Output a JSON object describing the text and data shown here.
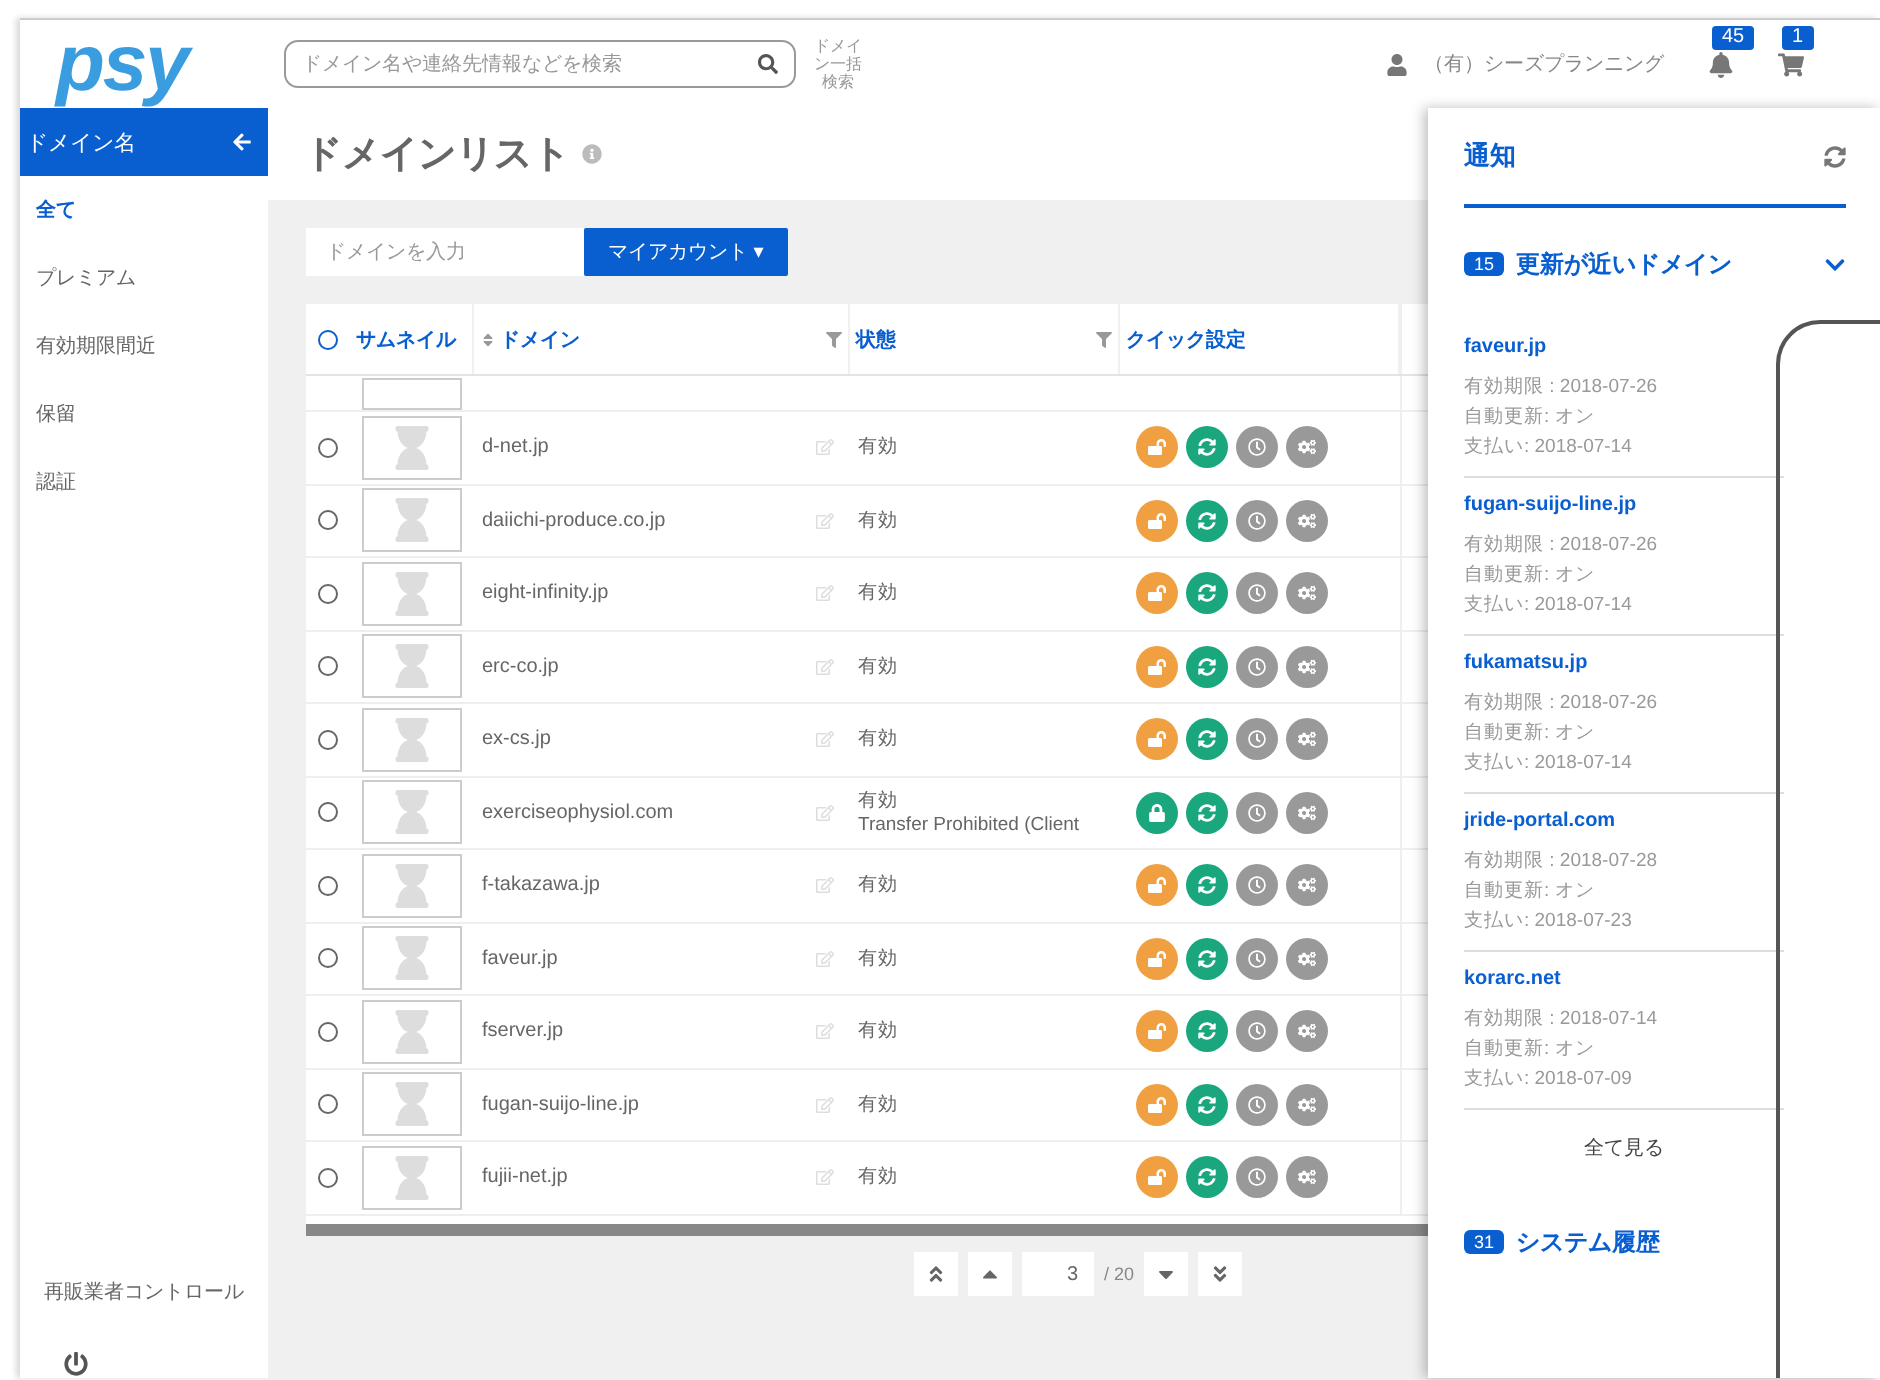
{
  "header": {
    "logo": "psy",
    "search": {
      "placeholder": "ドメイン名や連絡先情報などを検索"
    },
    "bulk_search": "ドメイン一括検索",
    "user": "（有）シーズプランニング",
    "notifications_badge": "45",
    "cart_badge": "1"
  },
  "sidebar": {
    "title": "ドメイン名",
    "items": [
      {
        "label": "全て",
        "selected": true
      },
      {
        "label": "プレミアム",
        "selected": false
      },
      {
        "label": "有効期限間近",
        "selected": false
      },
      {
        "label": "保留",
        "selected": false
      },
      {
        "label": "認証",
        "selected": false
      }
    ],
    "footer": "再販業者コントロール"
  },
  "page": {
    "title": "ドメインリスト",
    "filter": {
      "placeholder": "ドメインを入力"
    },
    "account_button": "マイアカウント ▾"
  },
  "table": {
    "all_selected": false,
    "columns": [
      {
        "label": "サムネイル",
        "sortable": false,
        "filter": false
      },
      {
        "label": "ドメイン",
        "sortable": true,
        "filter": true
      },
      {
        "label": "状態",
        "sortable": false,
        "filter": true
      },
      {
        "label": "クイック設定",
        "sortable": false,
        "filter": false
      }
    ],
    "rows": [
      {
        "domain": "d-net.jp",
        "status": [
          "有効"
        ],
        "locked": false,
        "selected": false
      },
      {
        "domain": "daiichi-produce.co.jp",
        "status": [
          "有効"
        ],
        "locked": false,
        "selected": false
      },
      {
        "domain": "eight-infinity.jp",
        "status": [
          "有効"
        ],
        "locked": false,
        "selected": false
      },
      {
        "domain": "erc-co.jp",
        "status": [
          "有効"
        ],
        "locked": false,
        "selected": false
      },
      {
        "domain": "ex-cs.jp",
        "status": [
          "有効"
        ],
        "locked": false,
        "selected": false
      },
      {
        "domain": "exerciseophysiol.com",
        "status": [
          "有効",
          "Transfer Prohibited (Client"
        ],
        "locked": true,
        "selected": false
      },
      {
        "domain": "f-takazawa.jp",
        "status": [
          "有効"
        ],
        "locked": false,
        "selected": false
      },
      {
        "domain": "faveur.jp",
        "status": [
          "有効"
        ],
        "locked": false,
        "selected": false
      },
      {
        "domain": "fserver.jp",
        "status": [
          "有効"
        ],
        "locked": false,
        "selected": false
      },
      {
        "domain": "fugan-suijo-line.jp",
        "status": [
          "有効"
        ],
        "locked": false,
        "selected": false
      },
      {
        "domain": "fujii-net.jp",
        "status": [
          "有効"
        ],
        "locked": false,
        "selected": false
      }
    ]
  },
  "pagination": {
    "page": "3",
    "total": "/ 20"
  },
  "notifications": {
    "title": "通知",
    "sections": [
      {
        "count": "15",
        "title": "更新が近いドメイン",
        "expanded": true,
        "items": [
          {
            "domain": "faveur.jp",
            "expiry": "有効期限 : 2018-07-26",
            "auto_renew": "自動更新: オン",
            "payment": "支払い: 2018-07-14"
          },
          {
            "domain": "fugan-suijo-line.jp",
            "expiry": "有効期限 : 2018-07-26",
            "auto_renew": "自動更新: オン",
            "payment": "支払い: 2018-07-14"
          },
          {
            "domain": "fukamatsu.jp",
            "expiry": "有効期限 : 2018-07-26",
            "auto_renew": "自動更新: オン",
            "payment": "支払い: 2018-07-14"
          },
          {
            "domain": "jride-portal.com",
            "expiry": "有効期限 : 2018-07-28",
            "auto_renew": "自動更新: オン",
            "payment": "支払い: 2018-07-23"
          },
          {
            "domain": "korarc.net",
            "expiry": "有効期限 : 2018-07-14",
            "auto_renew": "自動更新: オン",
            "payment": "支払い: 2018-07-09"
          }
        ],
        "see_all": "全て見る"
      },
      {
        "count": "31",
        "title": "システム履歴",
        "expanded": false
      }
    ]
  }
}
